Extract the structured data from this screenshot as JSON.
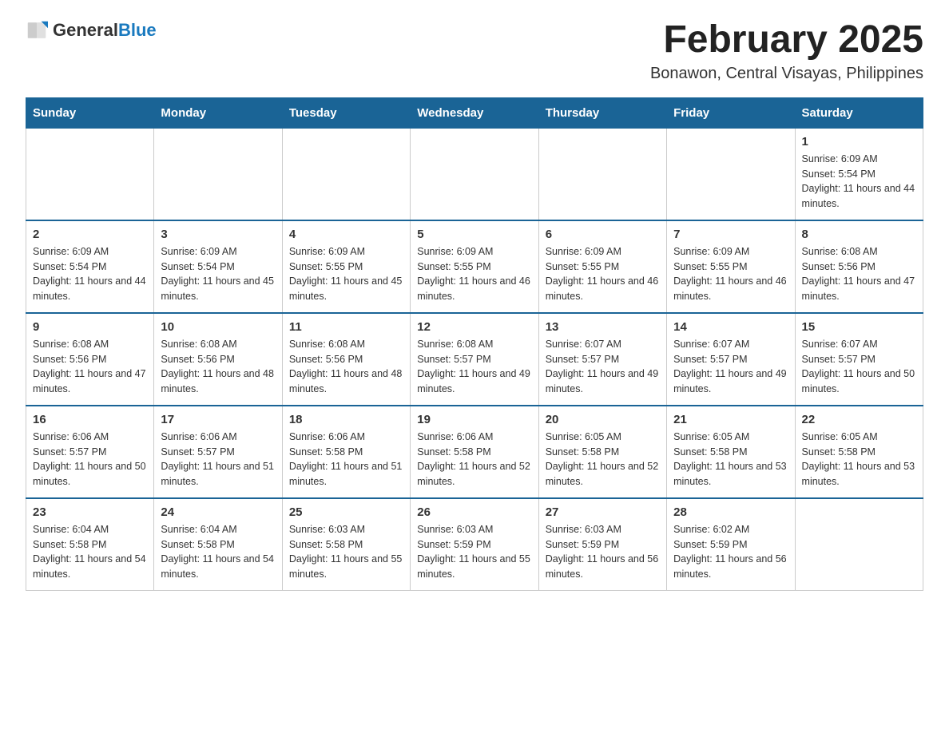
{
  "logo": {
    "text_general": "General",
    "text_blue": "Blue",
    "arrow_color": "#1a7abf"
  },
  "header": {
    "month_title": "February 2025",
    "location": "Bonawon, Central Visayas, Philippines"
  },
  "days_of_week": [
    "Sunday",
    "Monday",
    "Tuesday",
    "Wednesday",
    "Thursday",
    "Friday",
    "Saturday"
  ],
  "weeks": [
    [
      {
        "day": "",
        "sunrise": "",
        "sunset": "",
        "daylight": ""
      },
      {
        "day": "",
        "sunrise": "",
        "sunset": "",
        "daylight": ""
      },
      {
        "day": "",
        "sunrise": "",
        "sunset": "",
        "daylight": ""
      },
      {
        "day": "",
        "sunrise": "",
        "sunset": "",
        "daylight": ""
      },
      {
        "day": "",
        "sunrise": "",
        "sunset": "",
        "daylight": ""
      },
      {
        "day": "",
        "sunrise": "",
        "sunset": "",
        "daylight": ""
      },
      {
        "day": "1",
        "sunrise": "Sunrise: 6:09 AM",
        "sunset": "Sunset: 5:54 PM",
        "daylight": "Daylight: 11 hours and 44 minutes."
      }
    ],
    [
      {
        "day": "2",
        "sunrise": "Sunrise: 6:09 AM",
        "sunset": "Sunset: 5:54 PM",
        "daylight": "Daylight: 11 hours and 44 minutes."
      },
      {
        "day": "3",
        "sunrise": "Sunrise: 6:09 AM",
        "sunset": "Sunset: 5:54 PM",
        "daylight": "Daylight: 11 hours and 45 minutes."
      },
      {
        "day": "4",
        "sunrise": "Sunrise: 6:09 AM",
        "sunset": "Sunset: 5:55 PM",
        "daylight": "Daylight: 11 hours and 45 minutes."
      },
      {
        "day": "5",
        "sunrise": "Sunrise: 6:09 AM",
        "sunset": "Sunset: 5:55 PM",
        "daylight": "Daylight: 11 hours and 46 minutes."
      },
      {
        "day": "6",
        "sunrise": "Sunrise: 6:09 AM",
        "sunset": "Sunset: 5:55 PM",
        "daylight": "Daylight: 11 hours and 46 minutes."
      },
      {
        "day": "7",
        "sunrise": "Sunrise: 6:09 AM",
        "sunset": "Sunset: 5:55 PM",
        "daylight": "Daylight: 11 hours and 46 minutes."
      },
      {
        "day": "8",
        "sunrise": "Sunrise: 6:08 AM",
        "sunset": "Sunset: 5:56 PM",
        "daylight": "Daylight: 11 hours and 47 minutes."
      }
    ],
    [
      {
        "day": "9",
        "sunrise": "Sunrise: 6:08 AM",
        "sunset": "Sunset: 5:56 PM",
        "daylight": "Daylight: 11 hours and 47 minutes."
      },
      {
        "day": "10",
        "sunrise": "Sunrise: 6:08 AM",
        "sunset": "Sunset: 5:56 PM",
        "daylight": "Daylight: 11 hours and 48 minutes."
      },
      {
        "day": "11",
        "sunrise": "Sunrise: 6:08 AM",
        "sunset": "Sunset: 5:56 PM",
        "daylight": "Daylight: 11 hours and 48 minutes."
      },
      {
        "day": "12",
        "sunrise": "Sunrise: 6:08 AM",
        "sunset": "Sunset: 5:57 PM",
        "daylight": "Daylight: 11 hours and 49 minutes."
      },
      {
        "day": "13",
        "sunrise": "Sunrise: 6:07 AM",
        "sunset": "Sunset: 5:57 PM",
        "daylight": "Daylight: 11 hours and 49 minutes."
      },
      {
        "day": "14",
        "sunrise": "Sunrise: 6:07 AM",
        "sunset": "Sunset: 5:57 PM",
        "daylight": "Daylight: 11 hours and 49 minutes."
      },
      {
        "day": "15",
        "sunrise": "Sunrise: 6:07 AM",
        "sunset": "Sunset: 5:57 PM",
        "daylight": "Daylight: 11 hours and 50 minutes."
      }
    ],
    [
      {
        "day": "16",
        "sunrise": "Sunrise: 6:06 AM",
        "sunset": "Sunset: 5:57 PM",
        "daylight": "Daylight: 11 hours and 50 minutes."
      },
      {
        "day": "17",
        "sunrise": "Sunrise: 6:06 AM",
        "sunset": "Sunset: 5:57 PM",
        "daylight": "Daylight: 11 hours and 51 minutes."
      },
      {
        "day": "18",
        "sunrise": "Sunrise: 6:06 AM",
        "sunset": "Sunset: 5:58 PM",
        "daylight": "Daylight: 11 hours and 51 minutes."
      },
      {
        "day": "19",
        "sunrise": "Sunrise: 6:06 AM",
        "sunset": "Sunset: 5:58 PM",
        "daylight": "Daylight: 11 hours and 52 minutes."
      },
      {
        "day": "20",
        "sunrise": "Sunrise: 6:05 AM",
        "sunset": "Sunset: 5:58 PM",
        "daylight": "Daylight: 11 hours and 52 minutes."
      },
      {
        "day": "21",
        "sunrise": "Sunrise: 6:05 AM",
        "sunset": "Sunset: 5:58 PM",
        "daylight": "Daylight: 11 hours and 53 minutes."
      },
      {
        "day": "22",
        "sunrise": "Sunrise: 6:05 AM",
        "sunset": "Sunset: 5:58 PM",
        "daylight": "Daylight: 11 hours and 53 minutes."
      }
    ],
    [
      {
        "day": "23",
        "sunrise": "Sunrise: 6:04 AM",
        "sunset": "Sunset: 5:58 PM",
        "daylight": "Daylight: 11 hours and 54 minutes."
      },
      {
        "day": "24",
        "sunrise": "Sunrise: 6:04 AM",
        "sunset": "Sunset: 5:58 PM",
        "daylight": "Daylight: 11 hours and 54 minutes."
      },
      {
        "day": "25",
        "sunrise": "Sunrise: 6:03 AM",
        "sunset": "Sunset: 5:58 PM",
        "daylight": "Daylight: 11 hours and 55 minutes."
      },
      {
        "day": "26",
        "sunrise": "Sunrise: 6:03 AM",
        "sunset": "Sunset: 5:59 PM",
        "daylight": "Daylight: 11 hours and 55 minutes."
      },
      {
        "day": "27",
        "sunrise": "Sunrise: 6:03 AM",
        "sunset": "Sunset: 5:59 PM",
        "daylight": "Daylight: 11 hours and 56 minutes."
      },
      {
        "day": "28",
        "sunrise": "Sunrise: 6:02 AM",
        "sunset": "Sunset: 5:59 PM",
        "daylight": "Daylight: 11 hours and 56 minutes."
      },
      {
        "day": "",
        "sunrise": "",
        "sunset": "",
        "daylight": ""
      }
    ]
  ]
}
